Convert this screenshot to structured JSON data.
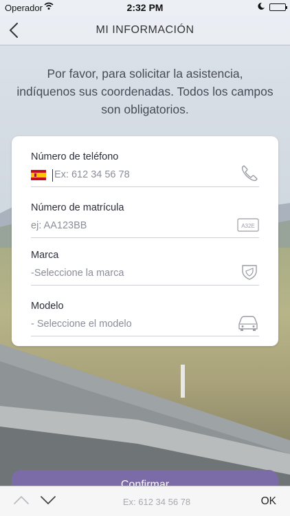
{
  "status_bar": {
    "carrier": "Operador",
    "time": "2:32 PM"
  },
  "nav": {
    "title": "MI INFORMACIÓN"
  },
  "intro_text": "Por favor, para solicitar la asistencia, indíquenos sus coordenadas. Todos los campos son obligatorios.",
  "form": {
    "phone": {
      "label": "Número de teléfono",
      "placeholder": "Ex: 612 34 56 78",
      "icon": "phone-icon"
    },
    "plate": {
      "label": "Número de matrícula",
      "placeholder": "ej: AA123BB",
      "icon": "license-plate-icon",
      "plate_icon_text": "A32E"
    },
    "brand": {
      "label": "Marca",
      "value": "-Seleccione la marca",
      "icon": "shield-icon"
    },
    "model": {
      "label": "Modelo",
      "value": "- Seleccione el modelo",
      "icon": "car-icon"
    }
  },
  "confirm_button": {
    "label": "Confirmar"
  },
  "keyboard_toolbar": {
    "hint": "Ex: 612 34 56 78",
    "done_label": "OK"
  },
  "colors": {
    "accent": "#7b6ba6",
    "text_dark": "#2b2e3a",
    "icon_gray": "#9a9ca4"
  }
}
